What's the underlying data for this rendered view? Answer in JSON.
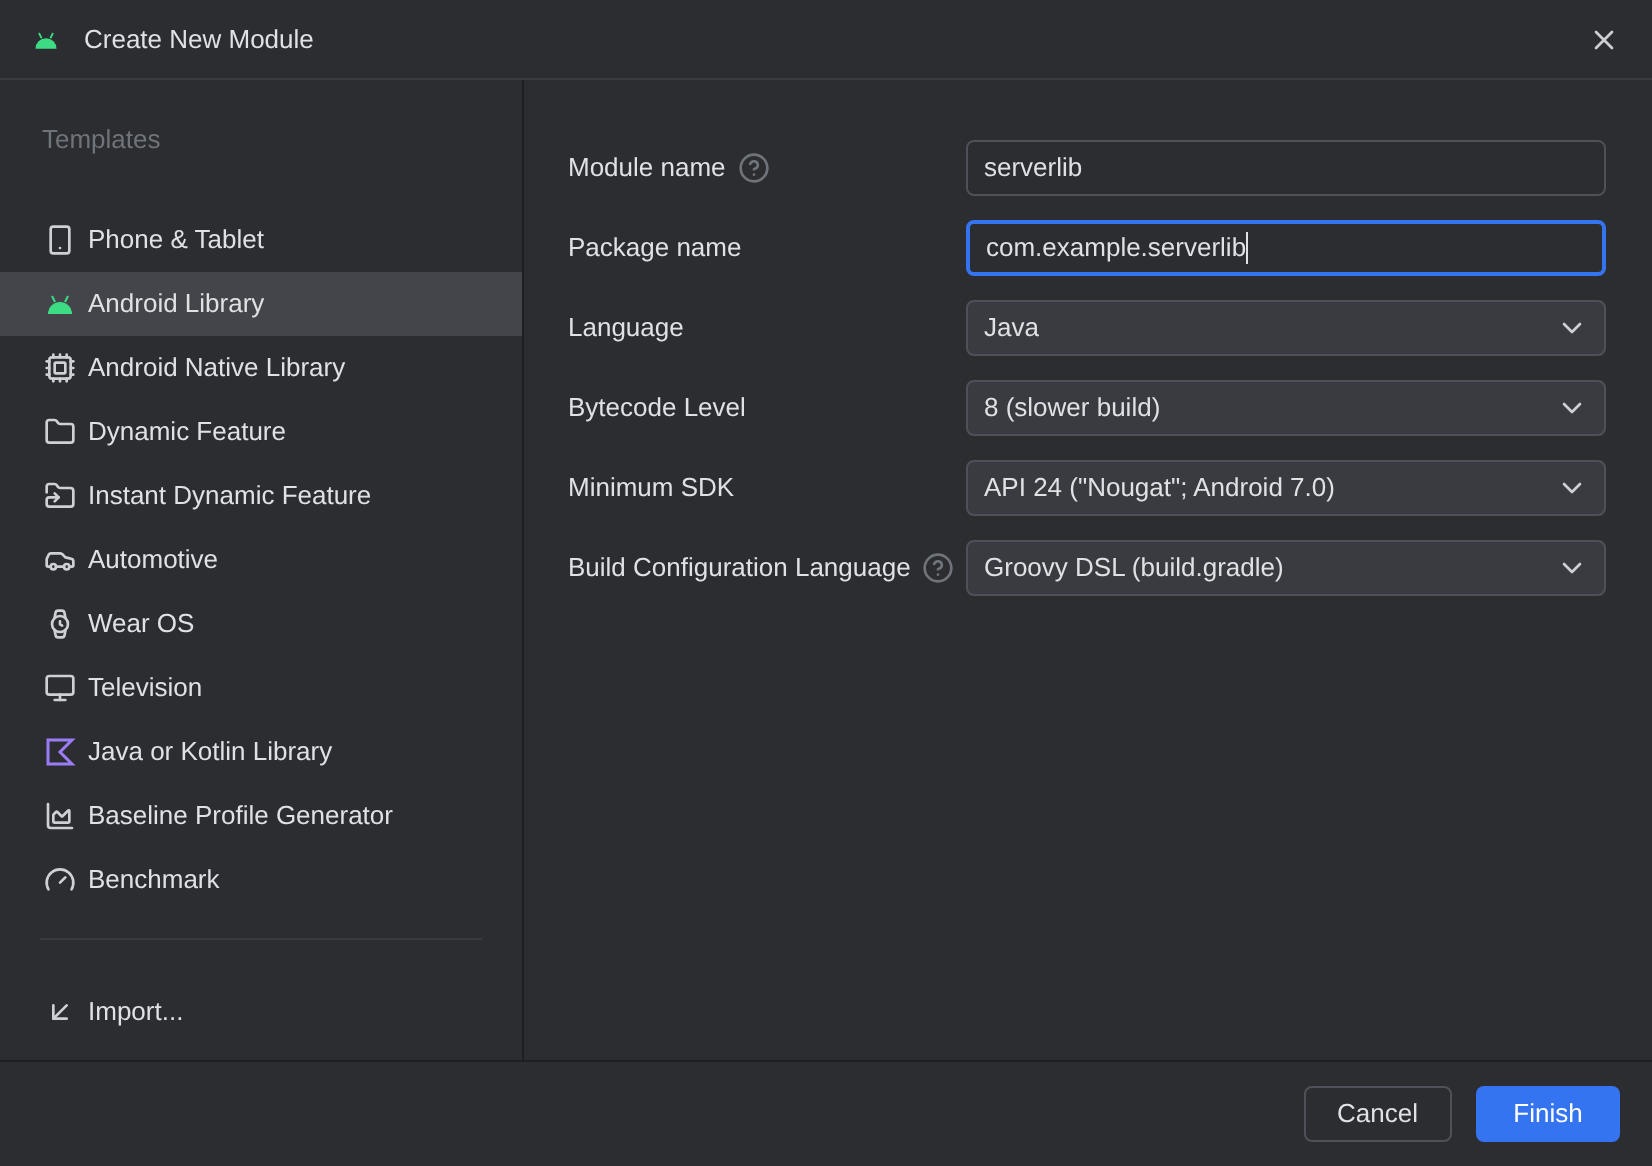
{
  "window": {
    "title": "Create New Module"
  },
  "sidebar": {
    "heading": "Templates",
    "items": [
      {
        "label": "Phone & Tablet",
        "kind": "phone",
        "selected": false
      },
      {
        "label": "Android Library",
        "kind": "android",
        "selected": true
      },
      {
        "label": "Android Native Library",
        "kind": "chip",
        "selected": false
      },
      {
        "label": "Dynamic Feature",
        "kind": "folder",
        "selected": false
      },
      {
        "label": "Instant Dynamic Feature",
        "kind": "folderbolt",
        "selected": false
      },
      {
        "label": "Automotive",
        "kind": "car",
        "selected": false
      },
      {
        "label": "Wear OS",
        "kind": "watch",
        "selected": false
      },
      {
        "label": "Television",
        "kind": "tv",
        "selected": false
      },
      {
        "label": "Java or Kotlin Library",
        "kind": "kotlin",
        "selected": false
      },
      {
        "label": "Baseline Profile Generator",
        "kind": "chart",
        "selected": false
      },
      {
        "label": "Benchmark",
        "kind": "gauge",
        "selected": false
      }
    ],
    "import": "Import..."
  },
  "form": [
    {
      "label": "Module name",
      "help": true,
      "kind": "text",
      "value": "serverlib",
      "focused": false
    },
    {
      "label": "Package name",
      "help": false,
      "kind": "text",
      "value": "com.example.serverlib",
      "focused": true
    },
    {
      "label": "Language",
      "help": false,
      "kind": "dropdown",
      "value": "Java"
    },
    {
      "label": "Bytecode Level",
      "help": false,
      "kind": "dropdown",
      "value": "8 (slower build)"
    },
    {
      "label": "Minimum SDK",
      "help": false,
      "kind": "dropdown",
      "value": "API 24 (\"Nougat\"; Android 7.0)"
    },
    {
      "label": "Build Configuration Language",
      "help": true,
      "kind": "dropdown",
      "value": "Groovy DSL (build.gradle)"
    }
  ],
  "buttons": [
    {
      "label": "Cancel",
      "primary": false
    },
    {
      "label": "Finish",
      "primary": true
    }
  ]
}
